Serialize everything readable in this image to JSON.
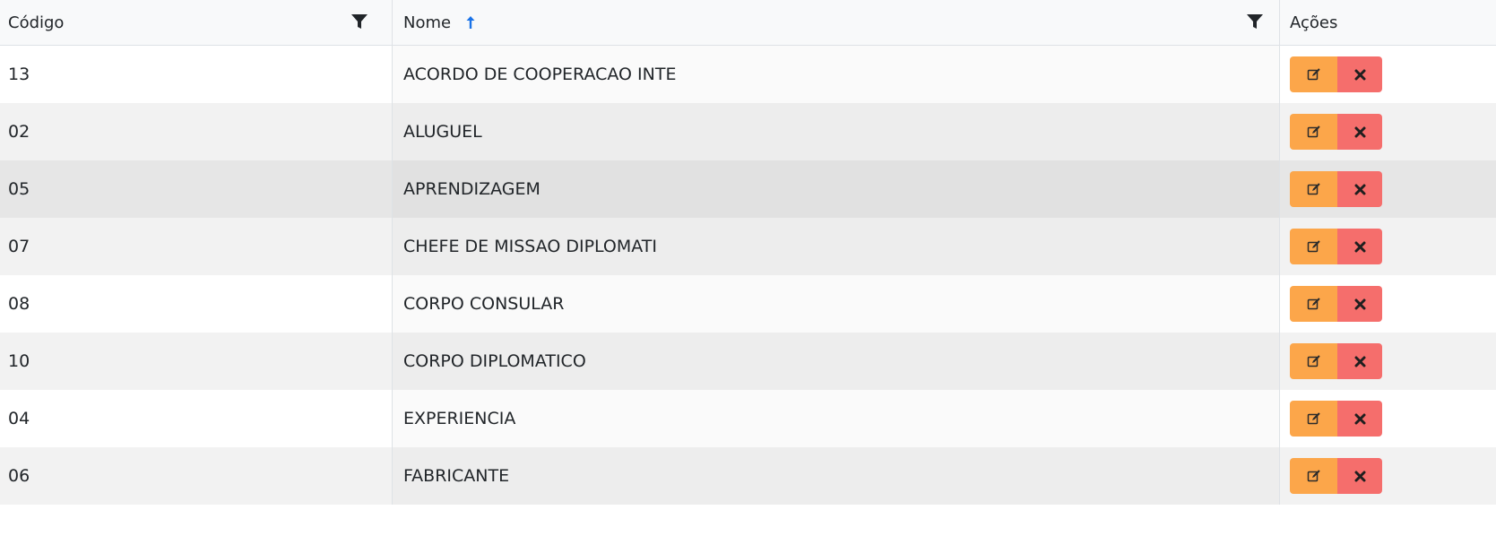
{
  "header": {
    "col_code": "Código",
    "col_name": "Nome",
    "col_actions": "Ações",
    "filter_icon": "filter-icon",
    "sort_icon": "arrow-up-icon",
    "sort_color": "#1a73e8"
  },
  "rows": [
    {
      "code": "13",
      "name": "ACORDO DE COOPERACAO INTE",
      "bg": "#ffffff"
    },
    {
      "code": "02",
      "name": "ALUGUEL",
      "bg": "#f2f2f2"
    },
    {
      "code": "05",
      "name": "APRENDIZAGEM",
      "bg": "#e6e6e6"
    },
    {
      "code": "07",
      "name": "CHEFE DE MISSAO DIPLOMATI",
      "bg": "#f2f2f2"
    },
    {
      "code": "08",
      "name": "CORPO CONSULAR",
      "bg": "#ffffff"
    },
    {
      "code": "10",
      "name": "CORPO DIPLOMATICO",
      "bg": "#f2f2f2"
    },
    {
      "code": "04",
      "name": "EXPERIENCIA",
      "bg": "#ffffff"
    },
    {
      "code": "06",
      "name": "FABRICANTE",
      "bg": "#f2f2f2"
    }
  ],
  "actions": {
    "edit_icon": "edit-icon",
    "delete_icon": "close-icon",
    "edit_color": "#fca64a",
    "delete_color": "#f56e6c"
  }
}
